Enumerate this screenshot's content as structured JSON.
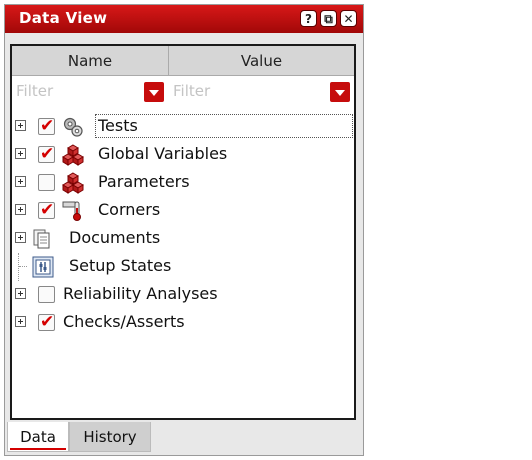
{
  "panel": {
    "title": "Data View",
    "buttons": {
      "help": "?",
      "restore": "⧉",
      "close": "✕"
    }
  },
  "columns": {
    "name": "Name",
    "value": "Value"
  },
  "filters": {
    "name_placeholder": "Filter",
    "value_placeholder": "Filter"
  },
  "tree": {
    "items": [
      {
        "label": "Tests",
        "checked": true,
        "expandable": true,
        "icon": "gear-icon"
      },
      {
        "label": "Global Variables",
        "checked": true,
        "expandable": true,
        "icon": "cubes-icon"
      },
      {
        "label": "Parameters",
        "checked": false,
        "expandable": true,
        "icon": "cubes-icon"
      },
      {
        "label": "Corners",
        "checked": true,
        "expandable": true,
        "icon": "thermometer-icon"
      },
      {
        "label": "Documents",
        "checked": null,
        "expandable": true,
        "icon": "documents-icon"
      },
      {
        "label": "Setup States",
        "checked": null,
        "expandable": false,
        "icon": "setup-states-icon"
      },
      {
        "label": "Reliability Analyses",
        "checked": false,
        "expandable": true,
        "icon": null
      },
      {
        "label": "Checks/Asserts",
        "checked": true,
        "expandable": true,
        "icon": null
      }
    ]
  },
  "tabs": {
    "data": "Data",
    "history": "History"
  },
  "colors": {
    "accent": "#c60c0c",
    "titlebar": "#b80d0d"
  }
}
